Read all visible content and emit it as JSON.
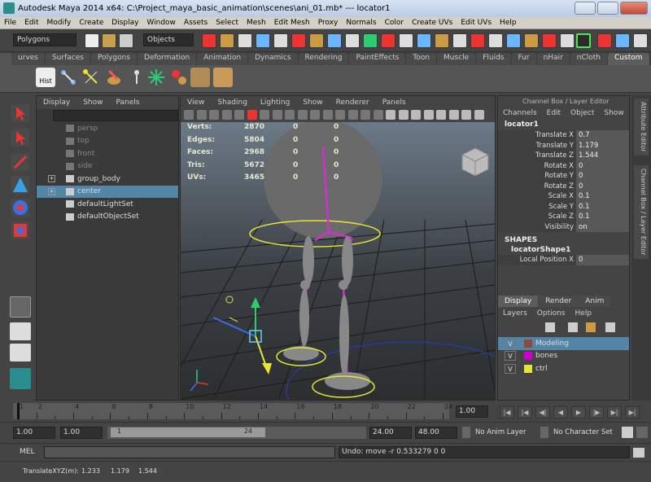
{
  "window": {
    "title": "Autodesk Maya 2014 x64: C:\\Project_maya_basic_animation\\scenes\\ani_01.mb*  ---  locator1"
  },
  "menubar": [
    "File",
    "Edit",
    "Modify",
    "Create",
    "Display",
    "Window",
    "Assets",
    "Select",
    "Mesh",
    "Edit Mesh",
    "Proxy",
    "Normals",
    "Color",
    "Create UVs",
    "Edit UVs",
    "Help"
  ],
  "statusline": {
    "menu_set": "Polygons",
    "object_field": "Objects"
  },
  "shelf_tabs": [
    "urves",
    "Surfaces",
    "Polygons",
    "Deformation",
    "Animation",
    "Dynamics",
    "Rendering",
    "PaintEffects",
    "Toon",
    "Muscle",
    "Fluids",
    "Fur",
    "nHair",
    "nCloth",
    "Custom"
  ],
  "shelf_active_tab": "Custom",
  "shelf_first_label": "Hist",
  "outliner": {
    "menu": [
      "Display",
      "Show",
      "Panels"
    ],
    "items": [
      {
        "label": "persp",
        "dim": true
      },
      {
        "label": "top",
        "dim": true
      },
      {
        "label": "front",
        "dim": true
      },
      {
        "label": "side",
        "dim": true
      },
      {
        "label": "group_body",
        "dim": false,
        "expandable": true
      },
      {
        "label": "center",
        "dim": false,
        "expandable": true,
        "selected": true
      },
      {
        "label": "defaultLightSet",
        "dim": false
      },
      {
        "label": "defaultObjectSet",
        "dim": false
      }
    ]
  },
  "viewport": {
    "menu": [
      "View",
      "Shading",
      "Lighting",
      "Show",
      "Renderer",
      "Panels"
    ],
    "hud": [
      {
        "key": "Verts:",
        "value": "2870",
        "c1": "0",
        "c2": "0"
      },
      {
        "key": "Edges:",
        "value": "5804",
        "c1": "0",
        "c2": "0"
      },
      {
        "key": "Faces:",
        "value": "2968",
        "c1": "0",
        "c2": "0"
      },
      {
        "key": "Tris:",
        "value": "5672",
        "c1": "0",
        "c2": "0"
      },
      {
        "key": "UVs:",
        "value": "3465",
        "c1": "0",
        "c2": "0"
      }
    ]
  },
  "channel_box": {
    "title": "Channel Box / Layer Editor",
    "menu": [
      "Channels",
      "Edit",
      "Object",
      "Show"
    ],
    "object": "locator1",
    "attributes": [
      {
        "name": "Translate X",
        "value": "0.7"
      },
      {
        "name": "Translate Y",
        "value": "1.179"
      },
      {
        "name": "Translate Z",
        "value": "1.544"
      },
      {
        "name": "Rotate X",
        "value": "0"
      },
      {
        "name": "Rotate Y",
        "value": "0"
      },
      {
        "name": "Rotate Z",
        "value": "0"
      },
      {
        "name": "Scale X",
        "value": "0.1"
      },
      {
        "name": "Scale Y",
        "value": "0.1"
      },
      {
        "name": "Scale Z",
        "value": "0.1"
      },
      {
        "name": "Visibility",
        "value": "on"
      }
    ],
    "shapes_label": "SHAPES",
    "shape_name": "locatorShape1",
    "shape_attr": {
      "name": "Local Position X",
      "value": "0"
    },
    "layer_tabs": [
      "Display",
      "Render",
      "Anim"
    ],
    "layer_menu": [
      "Layers",
      "Options",
      "Help"
    ],
    "layers": [
      {
        "vis": "V",
        "name": "Modeling",
        "color": "#8c4a3c",
        "selected": true
      },
      {
        "vis": "V",
        "name": "bones",
        "color": "#cc00cc",
        "selected": false
      },
      {
        "vis": "V",
        "name": "ctrl",
        "color": "#e6e632",
        "selected": false
      }
    ]
  },
  "side_tabs": [
    "Attribute Editor",
    "Channel Box / Layer Editor"
  ],
  "time_slider": {
    "ticks": [
      "1",
      "2",
      "4",
      "6",
      "8",
      "10",
      "12",
      "14",
      "16",
      "18",
      "20",
      "22",
      "24"
    ],
    "current_frame": "1.00"
  },
  "range_slider": {
    "start": "1.00",
    "playback_start": "1.00",
    "range_left": "1",
    "range_right": "24",
    "playback_end": "24.00",
    "end": "48.00",
    "anim_layer": "No Anim Layer",
    "char_set": "No Character Set"
  },
  "command_line": {
    "label": "MEL",
    "result": "Undo: move -r 0.533279 0 0"
  },
  "help_line": {
    "label": "TranslateXYZ(m):",
    "x": "1.233",
    "y": "1.179",
    "z": "1.544"
  },
  "colors": {
    "selection": "#5285a6",
    "bones": "#cc00cc",
    "ctrl": "#e6e632"
  }
}
